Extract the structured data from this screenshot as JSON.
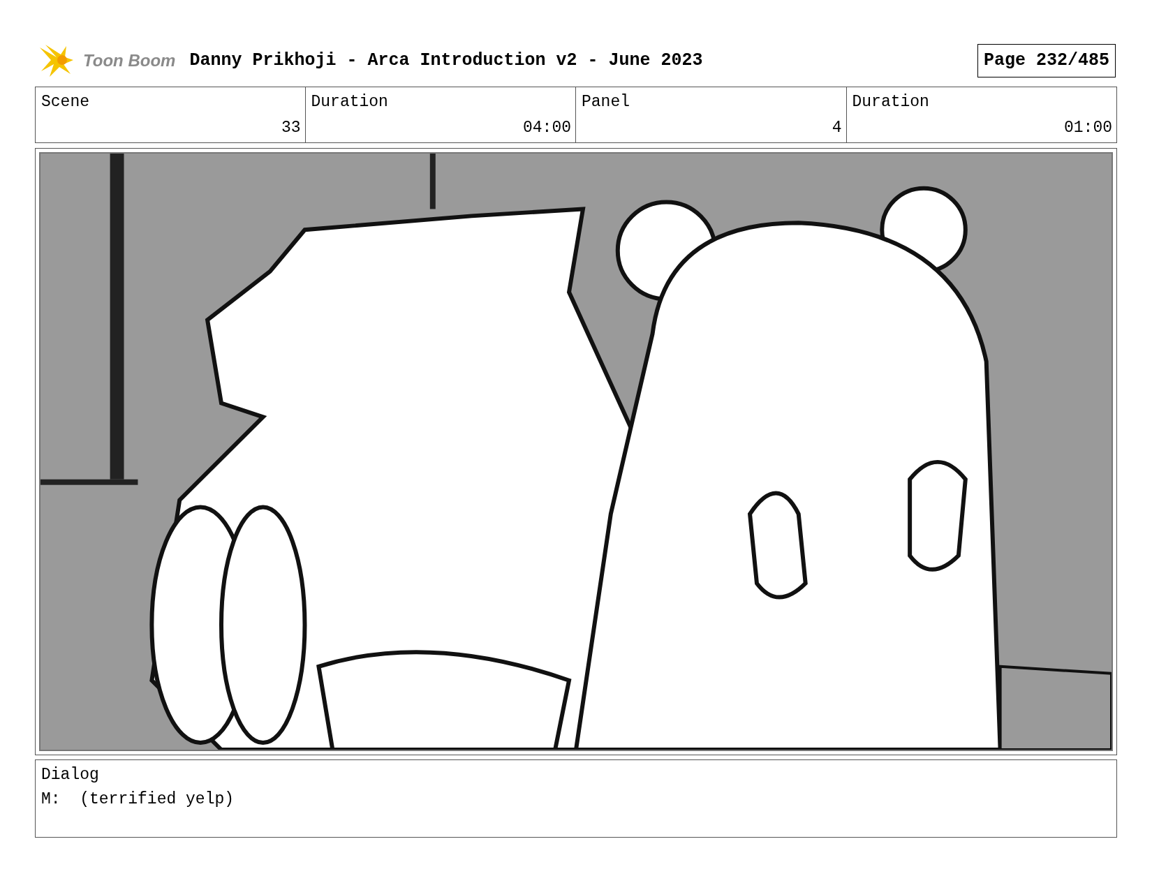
{
  "header": {
    "logo": "Toon Boom",
    "title": "Danny Prikhoji - Arca Introduction v2 - June 2023",
    "page": "Page 232/485"
  },
  "info_table": {
    "columns": [
      "Scene",
      "Duration",
      "Panel",
      "Duration"
    ],
    "values": [
      "33",
      "04:00",
      "4",
      "01:00"
    ]
  },
  "dialog": {
    "label": "Dialog",
    "text": "M:  (terrified yelp)"
  }
}
